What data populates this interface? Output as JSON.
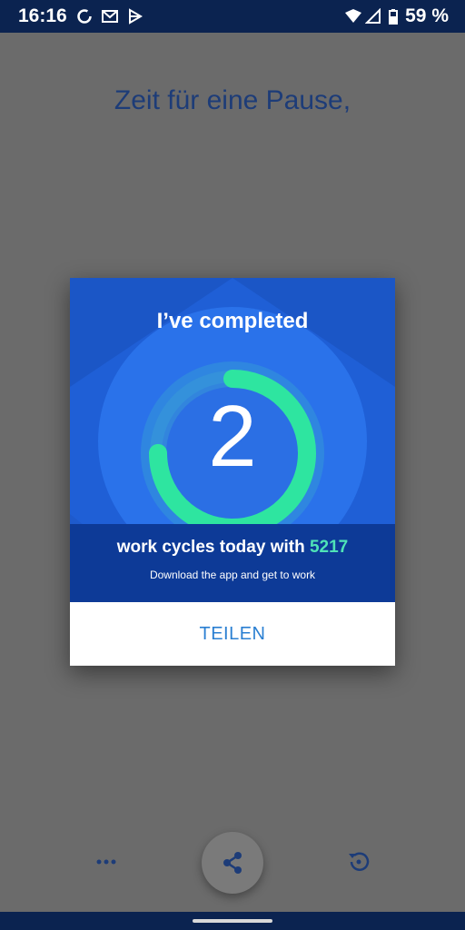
{
  "status_bar": {
    "time": "16:16",
    "battery_percent": "59 %",
    "icons": [
      "sync-icon",
      "gmail-icon",
      "play-icon",
      "wifi-icon",
      "signal-icon",
      "battery-icon"
    ]
  },
  "page": {
    "headline": "Zeit für eine Pause,"
  },
  "dialog": {
    "title": "I’ve completed",
    "count": "2",
    "cycles_text": "work cycles today with ",
    "app_count": "5217",
    "subtitle": "Download the app and get to work",
    "share_button": "TEILEN",
    "progress_fraction": 0.75
  },
  "bottom": {
    "icons": [
      "more-dots-icon",
      "share-icon",
      "history-icon"
    ]
  },
  "colors": {
    "status_bar": "#0b2350",
    "card_bg": "#1f5fd6",
    "ring_green": "#2ee5a0",
    "highlight": "#4fe3b7",
    "button_text": "#2a7fd2",
    "headline": "#1d3c78"
  }
}
